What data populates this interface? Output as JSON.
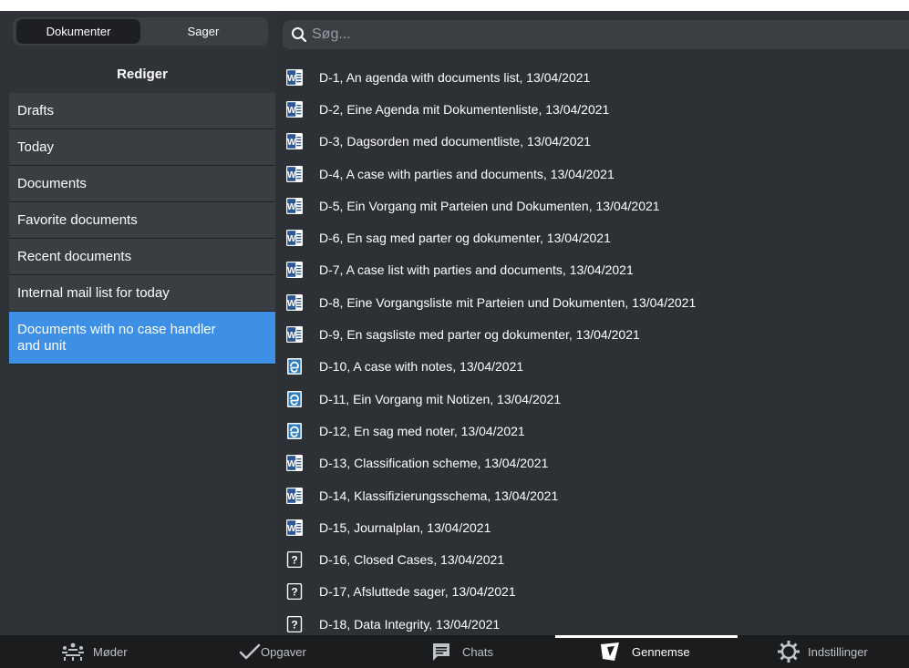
{
  "sidebar": {
    "segments": [
      "Dokumenter",
      "Sager"
    ],
    "edit_label": "Rediger",
    "items": [
      {
        "label": "Drafts"
      },
      {
        "label": "Today"
      },
      {
        "label": "Documents"
      },
      {
        "label": "Favorite documents"
      },
      {
        "label": "Recent documents"
      },
      {
        "label": "Internal mail list for today"
      },
      {
        "label": "Documents with no case handler and unit",
        "selected": true
      }
    ]
  },
  "search": {
    "placeholder": "Søg..."
  },
  "documents": [
    {
      "icon": "word-icon",
      "title": "D-1, An agenda with documents list, 13/04/2021"
    },
    {
      "icon": "word-icon",
      "title": "D-2, Eine Agenda mit Dokumentenliste, 13/04/2021"
    },
    {
      "icon": "word-icon",
      "title": "D-3, Dagsorden med documentliste, 13/04/2021"
    },
    {
      "icon": "word-icon",
      "title": "D-4, A case with parties and documents, 13/04/2021"
    },
    {
      "icon": "word-icon",
      "title": "D-5, Ein Vorgang mit Parteien und Dokumenten, 13/04/2021"
    },
    {
      "icon": "word-icon",
      "title": "D-6, En sag med parter og dokumenter, 13/04/2021"
    },
    {
      "icon": "word-icon",
      "title": "D-7, A case list with parties and documents, 13/04/2021"
    },
    {
      "icon": "word-icon",
      "title": "D-8, Eine Vorgangsliste mit Parteien und Dokumenten, 13/04/2021"
    },
    {
      "icon": "word-icon",
      "title": "D-9, En sagsliste med parter og dokumenter, 13/04/2021"
    },
    {
      "icon": "note-icon",
      "title": "D-10, A case with notes, 13/04/2021"
    },
    {
      "icon": "note-icon",
      "title": "D-11, Ein Vorgang mit Notizen, 13/04/2021"
    },
    {
      "icon": "note-icon",
      "title": "D-12, En sag med noter, 13/04/2021"
    },
    {
      "icon": "word-icon",
      "title": "D-13, Classification scheme, 13/04/2021"
    },
    {
      "icon": "word-icon",
      "title": "D-14, Klassifizierungsschema, 13/04/2021"
    },
    {
      "icon": "word-icon",
      "title": "D-15, Journalplan, 13/04/2021"
    },
    {
      "icon": "unknown-file-icon",
      "title": "D-16, Closed Cases, 13/04/2021"
    },
    {
      "icon": "unknown-file-icon",
      "title": "D-17, Afsluttede sager, 13/04/2021"
    },
    {
      "icon": "unknown-file-icon",
      "title": "D-18, Data Integrity, 13/04/2021"
    }
  ],
  "tabbar": {
    "tabs": [
      {
        "label": "Møder",
        "icon": "meetings-icon"
      },
      {
        "label": "Opgaver",
        "icon": "checkmark-icon"
      },
      {
        "label": "Chats",
        "icon": "chat-icon"
      },
      {
        "label": "Gennemse",
        "icon": "browse-icon",
        "active": true
      },
      {
        "label": "Indstillinger",
        "icon": "gear-icon"
      }
    ]
  },
  "colors": {
    "accent": "#3e90e6",
    "background": "#2f3236",
    "word_blue": "#2b5797"
  }
}
